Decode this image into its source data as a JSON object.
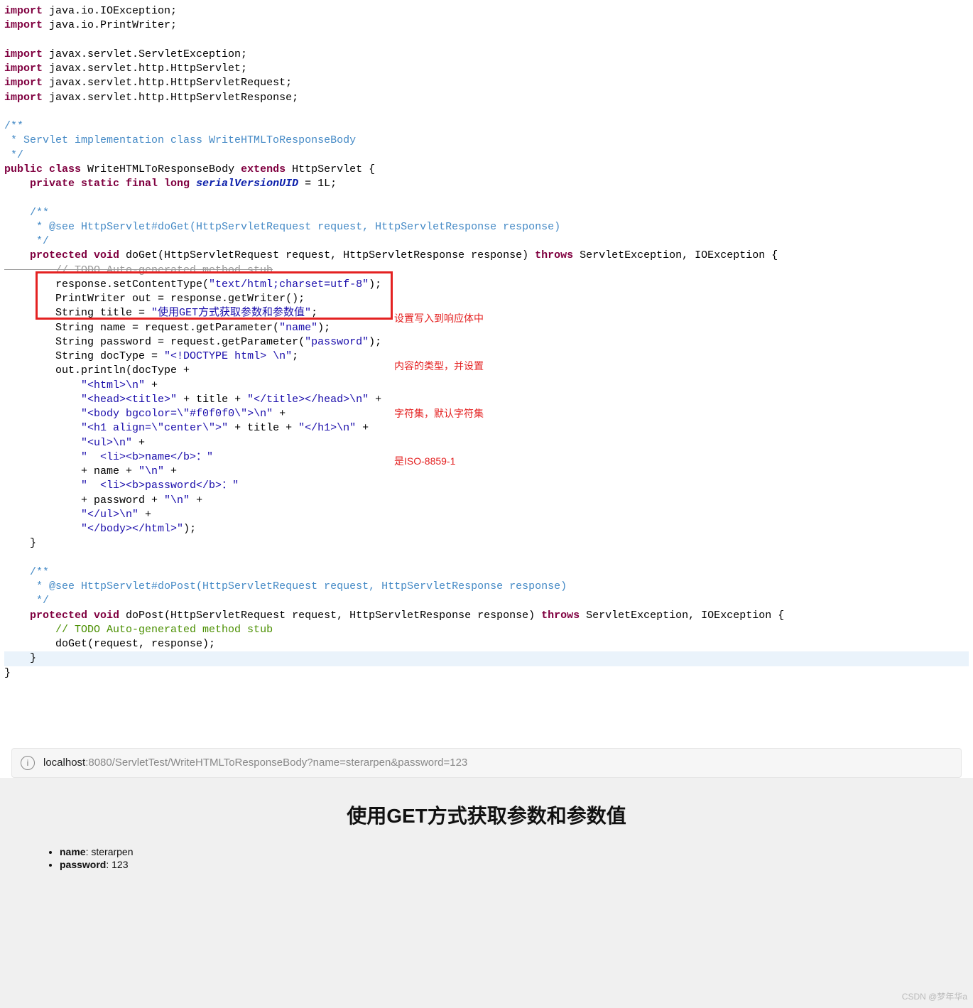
{
  "code": {
    "imports": [
      [
        [
          "kw",
          "import"
        ],
        [
          "",
          " java.io.IOException;"
        ]
      ],
      [
        [
          "kw",
          "import"
        ],
        [
          "",
          " java.io.PrintWriter;"
        ]
      ],
      [
        [
          "",
          ""
        ]
      ],
      [
        [
          "kw",
          "import"
        ],
        [
          "",
          " javax.servlet.ServletException;"
        ]
      ],
      [
        [
          "kw",
          "import"
        ],
        [
          "",
          " javax.servlet.http.HttpServlet;"
        ]
      ],
      [
        [
          "kw",
          "import"
        ],
        [
          "",
          " javax.servlet.http.HttpServletRequest;"
        ]
      ],
      [
        [
          "kw",
          "import"
        ],
        [
          "",
          " javax.servlet.http.HttpServletResponse;"
        ]
      ]
    ],
    "javadoc1": [
      "/**",
      " * Servlet implementation class WriteHTMLToResponseBody",
      " */"
    ],
    "class_decl": [
      [
        "kw",
        "public class"
      ],
      [
        "",
        " WriteHTMLToResponseBody "
      ],
      [
        "kw",
        "extends"
      ],
      [
        "",
        " HttpServlet {"
      ]
    ],
    "serial": [
      [
        "kw",
        "    private static final long "
      ],
      [
        "serial",
        "serialVersionUID"
      ],
      [
        "",
        " = 1L;"
      ]
    ],
    "javadoc2": [
      "    /**",
      "     * @see HttpServlet#doGet(HttpServletRequest request, HttpServletResponse response)",
      "     */"
    ],
    "doGet_decl": [
      [
        "kw",
        "    protected void"
      ],
      [
        "",
        " doGet(HttpServletRequest request, HttpServletResponse response) "
      ],
      [
        "kw",
        "throws"
      ],
      [
        "",
        " ServletException, IOException {"
      ]
    ],
    "todo_strike": "        // TODO Auto-generated method stub",
    "set_ct": [
      [
        "",
        "        response.setContentType("
      ],
      [
        "str",
        "\"text/html;charset=utf-8\""
      ],
      [
        "",
        ");"
      ]
    ],
    "pw": "        PrintWriter out = response.getWriter();",
    "title": [
      [
        "",
        "        String title = "
      ],
      [
        "str",
        "\"使用GET方式获取参数和参数值\""
      ],
      [
        "",
        ";"
      ]
    ],
    "name": [
      [
        "",
        "        String name = request.getParameter("
      ],
      [
        "str",
        "\"name\""
      ],
      [
        "",
        ");"
      ]
    ],
    "pwd": [
      [
        "",
        "        String password = request.getParameter("
      ],
      [
        "str",
        "\"password\""
      ],
      [
        "",
        ");"
      ]
    ],
    "doctype": [
      [
        "",
        "        String docType = "
      ],
      [
        "str",
        "\"<!DOCTYPE html> \\n\""
      ],
      [
        "",
        ";"
      ]
    ],
    "println_open": "        out.println(docType +",
    "concat": [
      [
        [
          "",
          "            "
        ],
        [
          "str",
          "\"<html>\\n\""
        ],
        [
          "",
          " +"
        ]
      ],
      [
        [
          "",
          "            "
        ],
        [
          "str",
          "\"<head><title>\""
        ],
        [
          "",
          " + title + "
        ],
        [
          "str",
          "\"</title></head>\\n\""
        ],
        [
          "",
          " +"
        ]
      ],
      [
        [
          "",
          "            "
        ],
        [
          "str",
          "\"<body bgcolor=\\\"#f0f0f0\\\">\\n\""
        ],
        [
          "",
          " +"
        ]
      ],
      [
        [
          "",
          "            "
        ],
        [
          "str",
          "\"<h1 align=\\\"center\\\">\""
        ],
        [
          "",
          " + title + "
        ],
        [
          "str",
          "\"</h1>\\n\""
        ],
        [
          "",
          " +"
        ]
      ],
      [
        [
          "",
          "            "
        ],
        [
          "str",
          "\"<ul>\\n\""
        ],
        [
          "",
          " +"
        ]
      ],
      [
        [
          "",
          "            "
        ],
        [
          "str",
          "\"  <li><b>name</b>：\""
        ]
      ],
      [
        [
          "",
          "            + name + "
        ],
        [
          "str",
          "\"\\n\""
        ],
        [
          "",
          " +"
        ]
      ],
      [
        [
          "",
          "            "
        ],
        [
          "str",
          "\"  <li><b>password</b>：\""
        ]
      ],
      [
        [
          "",
          "            + password + "
        ],
        [
          "str",
          "\"\\n\""
        ],
        [
          "",
          " +"
        ]
      ],
      [
        [
          "",
          "            "
        ],
        [
          "str",
          "\"</ul>\\n\""
        ],
        [
          "",
          " +"
        ]
      ],
      [
        [
          "",
          "            "
        ],
        [
          "str",
          "\"</body></html>\""
        ],
        [
          "",
          ");"
        ]
      ]
    ],
    "close_doGet": "    }",
    "javadoc3": [
      "    /**",
      "     * @see HttpServlet#doPost(HttpServletRequest request, HttpServletResponse response)",
      "     */"
    ],
    "doPost_decl": [
      [
        "kw",
        "    protected void"
      ],
      [
        "",
        " doPost(HttpServletRequest request, HttpServletResponse response) "
      ],
      [
        "kw",
        "throws"
      ],
      [
        "",
        " ServletException, IOException {"
      ]
    ],
    "todo2": [
      [
        "",
        "        "
      ],
      [
        "cmt-green",
        "// TODO Auto-generated method stub"
      ]
    ],
    "doPost_body": "        doGet(request, response);",
    "close_doPost": "    }",
    "close_class": "}"
  },
  "annotation": {
    "l1": "设置写入到响应体中",
    "l2": "内容的类型，并设置",
    "l3": "字符集，默认字符集",
    "l4": "是ISO-8859-1"
  },
  "url": {
    "host": "localhost",
    "rest": ":8080/ServletTest/WriteHTMLToResponseBody?name=sterarpen&password=123"
  },
  "browser": {
    "h1": "使用GET方式获取参数和参数值",
    "li1_label": "name",
    "li1_value": ": sterarpen",
    "li2_label": "password",
    "li2_value": ": 123"
  },
  "watermark": "CSDN @梦年华a"
}
